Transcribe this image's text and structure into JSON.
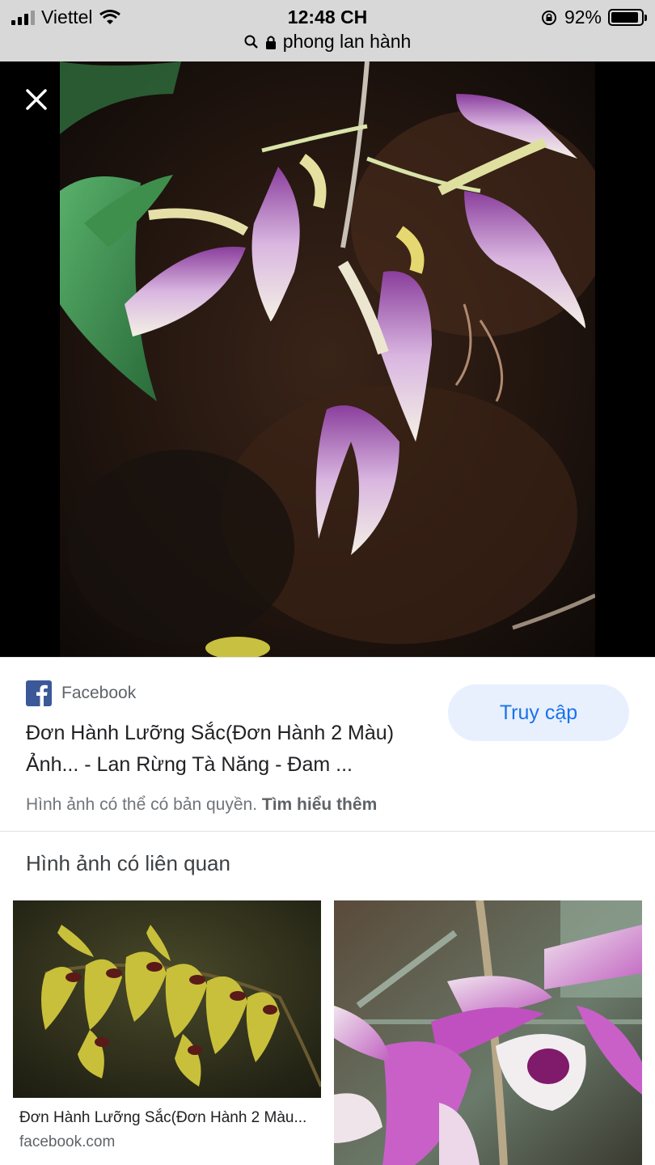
{
  "status_bar": {
    "carrier": "Viettel",
    "time": "12:48 CH",
    "battery": "92%",
    "battery_level": 0.92,
    "url": "phong lan hành"
  },
  "viewer": {
    "close_icon": "close-icon"
  },
  "result": {
    "source": "Facebook",
    "title_line1": "Đơn Hành Lưỡng Sắc(Đơn Hành 2 Màu)",
    "title_line2": "Ảnh... - Lan Rừng Tà Năng - Đam ...",
    "visit_label": "Truy cập",
    "copyright_text": "Hình ảnh có thể có bản quyền.",
    "learn_more": "Tìm hiểu thêm"
  },
  "related": {
    "heading": "Hình ảnh có liên quan",
    "items": [
      {
        "title": "Đơn Hành Lưỡng Sắc(Đơn Hành 2 Màu...",
        "domain": "facebook.com"
      },
      {
        "title": "",
        "domain": ""
      }
    ]
  },
  "colors": {
    "accent": "#1a73e8",
    "button_bg": "#e8f0fe",
    "facebook": "#3b5998"
  }
}
